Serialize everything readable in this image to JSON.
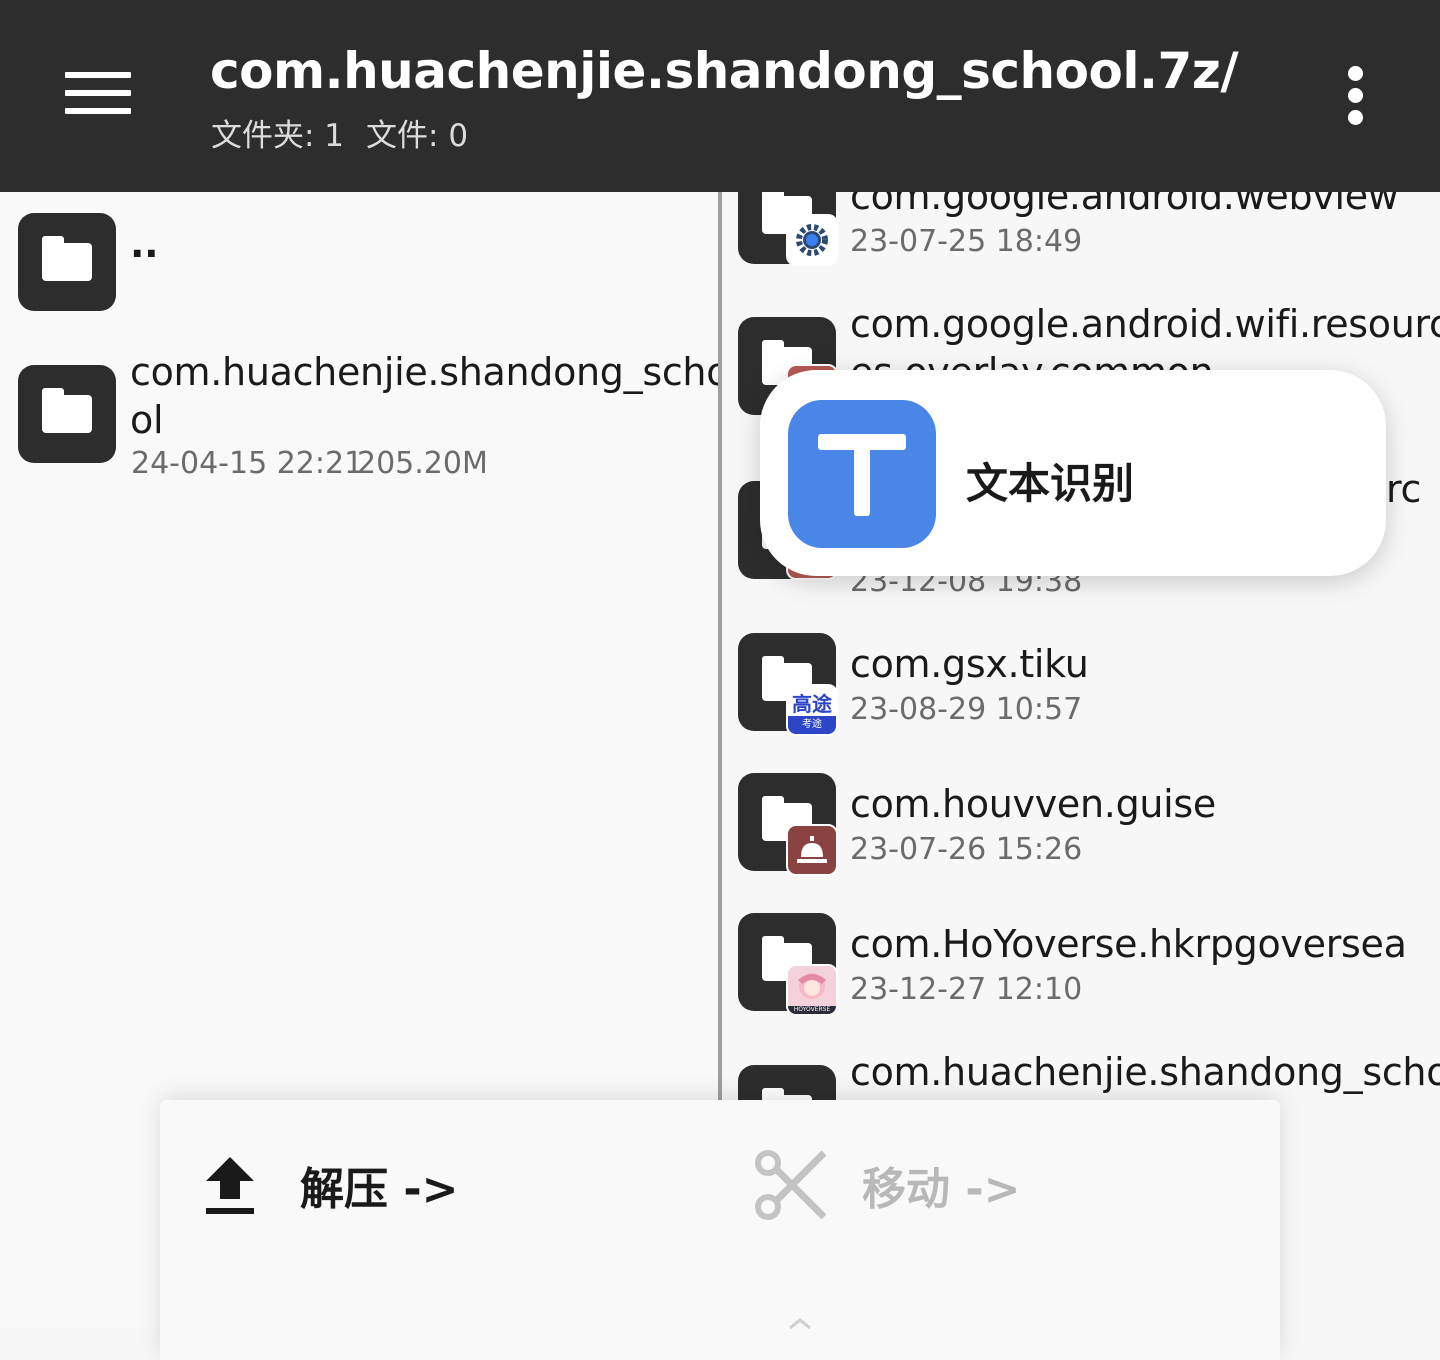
{
  "appbar": {
    "title": "com.huachenjie.shandong_school.7z/",
    "folder_count": "文件夹: 1",
    "file_count": "文件: 0",
    "menu_icon": "hamburger-menu-icon",
    "more_icon": "more-vert-icon"
  },
  "left_pane": {
    "items": [
      {
        "name": "..",
        "meta": ""
      },
      {
        "name_line1": "com.huachenjie.shandong_scho",
        "name_line2": "ol",
        "date": "24-04-15 22:21",
        "size": "205.20M"
      }
    ]
  },
  "right_pane": {
    "items": [
      {
        "name": "com.google.android.webview",
        "date": "23-07-25 18:49",
        "badge": "gear-icon",
        "badge_color": "#ffffff"
      },
      {
        "name": "com.google.android.wifi.resourc",
        "name_line2": "es.overlay.common",
        "date": "",
        "badge": "app-icon",
        "badge_color": "#b85a55"
      },
      {
        "name": "rc",
        "date": "23-12-08 19:38",
        "badge": "app-icon",
        "badge_color": "#b85a55"
      },
      {
        "name": "com.gsx.tiku",
        "date": "23-08-29 10:57",
        "badge_text": "高途",
        "badge_sub": "考途",
        "badge_color": "#2d46c8"
      },
      {
        "name": "com.houvven.guise",
        "date": "23-07-26 15:26",
        "badge": "bell-icon",
        "badge_color": "#8a4340"
      },
      {
        "name": "com.HoYoverse.hkrpgoversea",
        "date": "23-12-27 12:10",
        "badge_text": "HOYOVERSE",
        "badge_color": "#f0c8d4"
      },
      {
        "name": "com.huachenjie.shandong_scho",
        "date": "",
        "badge": "",
        "badge_color": ""
      }
    ]
  },
  "popup": {
    "label": "文本识别",
    "icon": "text-recognition-icon",
    "icon_color": "#4a86e8"
  },
  "sheet": {
    "extract_label": "解压 ->",
    "move_label": "移动 ->",
    "extract_icon": "upload-icon",
    "move_icon": "scissors-icon"
  }
}
